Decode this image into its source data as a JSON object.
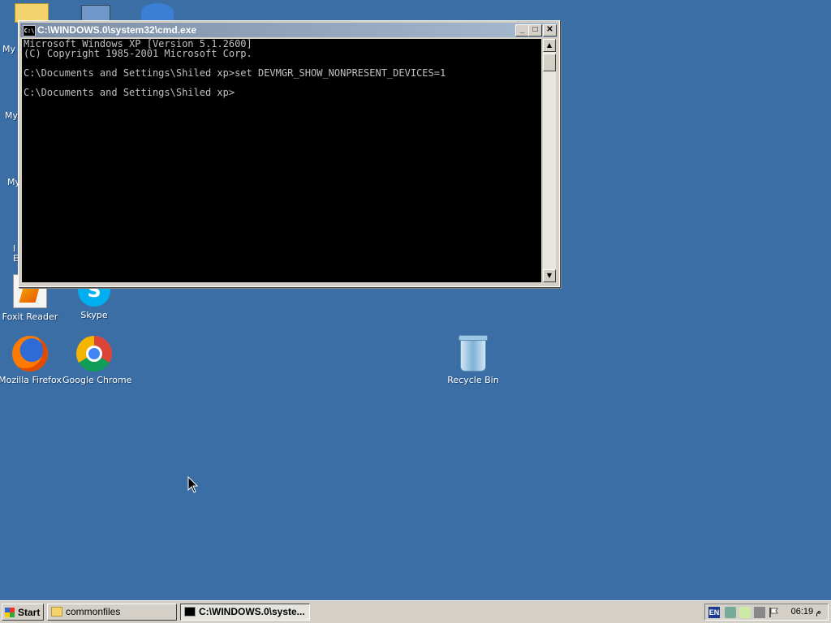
{
  "desktop": {
    "partial_labels": [
      "My D",
      "My",
      "My",
      "I",
      "E"
    ],
    "icons": [
      {
        "label": "Foxit Reader",
        "icon": "foxit-reader-icon"
      },
      {
        "label": "Skype",
        "icon": "skype-icon"
      },
      {
        "label": "Mozilla Firefox",
        "icon": "firefox-icon"
      },
      {
        "label": "Google Chrome",
        "icon": "chrome-icon"
      },
      {
        "label": "Recycle Bin",
        "icon": "recycle-bin-icon"
      }
    ],
    "background_color": "#3a6ea5"
  },
  "cmd_window": {
    "title": "C:\\WINDOWS.0\\system32\\cmd.exe",
    "title_icon_text": "C:\\",
    "buttons": {
      "minimize": "_",
      "maximize": "□",
      "close": "✕"
    },
    "lines": [
      "Microsoft Windows XP [Version 5.1.2600]",
      "(C) Copyright 1985-2001 Microsoft Corp.",
      "",
      "C:\\Documents and Settings\\Shiled xp>set DEVMGR_SHOW_NONPRESENT_DEVICES=1",
      "",
      "C:\\Documents and Settings\\Shiled xp>"
    ]
  },
  "taskbar": {
    "start_label": "Start",
    "tasks": [
      {
        "label": "commonfiles",
        "icon": "folder-icon",
        "active": false
      },
      {
        "label": "C:\\WINDOWS.0\\syste...",
        "icon": "cmd-icon",
        "active": true
      }
    ],
    "tray": {
      "language": "EN",
      "clock": "06:19 م"
    }
  }
}
